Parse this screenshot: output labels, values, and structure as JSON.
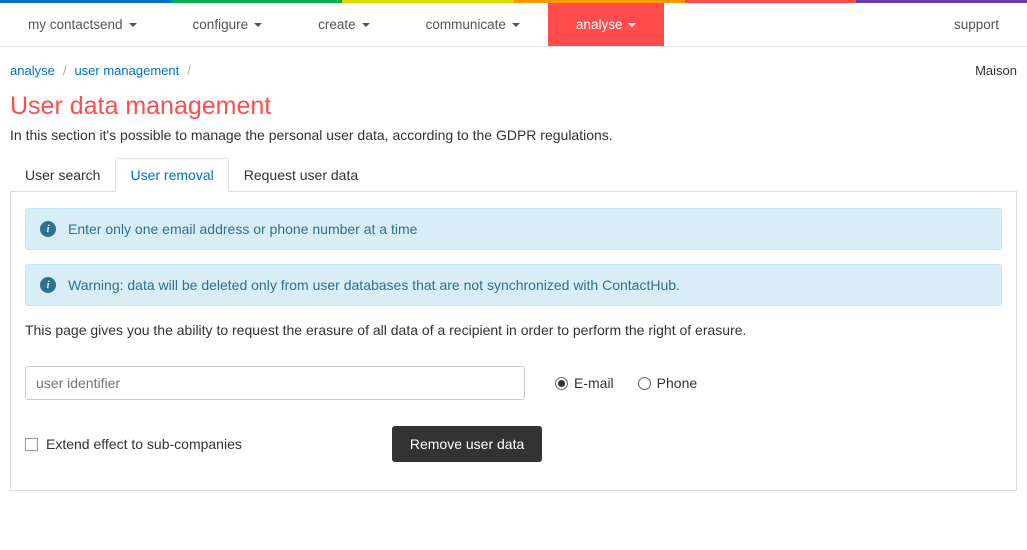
{
  "nav": {
    "items": [
      {
        "label": "my contactsend"
      },
      {
        "label": "configure"
      },
      {
        "label": "create"
      },
      {
        "label": "communicate"
      },
      {
        "label": "analyse",
        "active": true
      }
    ],
    "support": "support"
  },
  "breadcrumb": {
    "items": [
      "analyse",
      "user management"
    ],
    "right": "Maison"
  },
  "page": {
    "title": "User data management",
    "subtitle": "In this section it's possible to manage the personal user data, according to the GDPR regulations."
  },
  "tabs": [
    {
      "label": "User search"
    },
    {
      "label": "User removal",
      "active": true
    },
    {
      "label": "Request user data"
    }
  ],
  "alerts": [
    "Enter only one email address or phone number at a time",
    "Warning: data will be deleted only from user databases that are not synchronized with ContactHub."
  ],
  "panel": {
    "desc": "This page gives you the ability to request the erasure of all data of a recipient in order to perform the right of erasure.",
    "input_placeholder": "user identifier",
    "radio_email": "E-mail",
    "radio_phone": "Phone",
    "checkbox_label": "Extend effect to sub-companies",
    "button_label": "Remove user data"
  }
}
